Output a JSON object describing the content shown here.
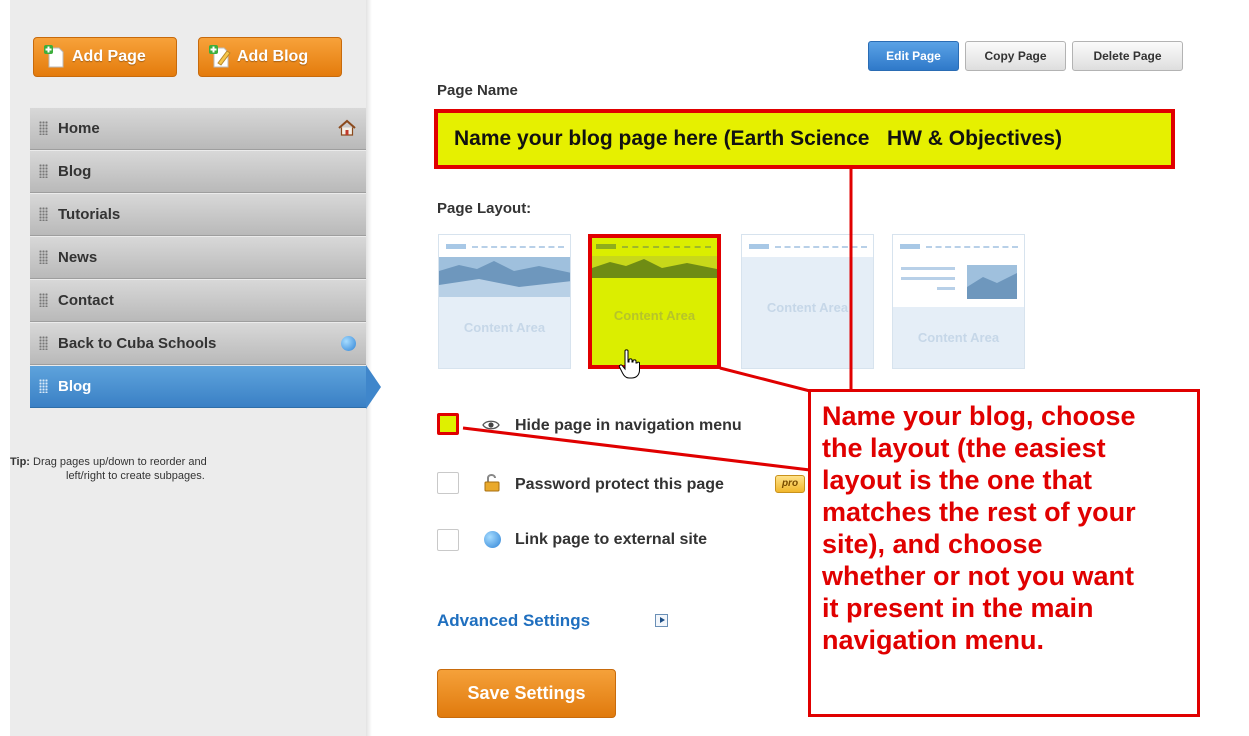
{
  "sidebar": {
    "add_page_label": "Add Page",
    "add_blog_label": "Add Blog",
    "items": [
      {
        "label": "Home"
      },
      {
        "label": "Blog"
      },
      {
        "label": "Tutorials"
      },
      {
        "label": "News"
      },
      {
        "label": "Contact"
      },
      {
        "label": "Back to Cuba Schools"
      },
      {
        "label": "Blog"
      }
    ],
    "active_item": "Blog",
    "tip_label": "Tip:",
    "tip_line1": "Drag pages up/down to reorder and",
    "tip_line2": "left/right to create subpages."
  },
  "toolbar": {
    "edit_page": "Edit Page",
    "copy_page": "Copy Page",
    "delete_page": "Delete Page"
  },
  "page_name": {
    "label": "Page Name",
    "value": "Name your blog page here (Earth Science   HW & Objectives)"
  },
  "page_layout": {
    "label": "Page Layout:",
    "options": [
      {
        "content_label": "Content Area"
      },
      {
        "content_label": "Content Area"
      },
      {
        "content_label": "Content Area"
      },
      {
        "content_label": "Content Area"
      }
    ],
    "selected_index": 1
  },
  "options": {
    "hide_page": "Hide page in navigation menu",
    "password_protect": "Password protect this page",
    "pro_badge": "pro",
    "link_external": "Link page to external site"
  },
  "advanced_settings": "Advanced Settings",
  "save_settings": "Save Settings",
  "annotation": {
    "lines": [
      "Name your blog, choose",
      "the layout (the easiest",
      "layout is the one that",
      "matches the rest of your",
      "site), and choose",
      "whether or not you want",
      "it present in the main",
      "navigation menu."
    ]
  },
  "colors": {
    "accent_blue": "#3a80c5",
    "orange": "#e47b0c",
    "highlight_yellow": "#e6f000",
    "annotation_red": "#e00000"
  }
}
